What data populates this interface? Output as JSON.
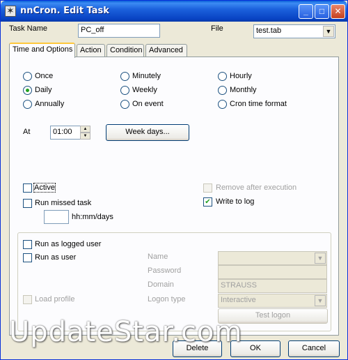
{
  "window": {
    "title": "nnCron. Edit Task",
    "minimize_glyph": "_",
    "maximize_glyph": "□",
    "close_glyph": "✕"
  },
  "header": {
    "task_name_label": "Task Name",
    "task_name_value": "PC_off",
    "file_label": "File",
    "file_value": "test.tab"
  },
  "tabs": [
    {
      "label": "Time and Options",
      "active": true
    },
    {
      "label": "Action",
      "active": false
    },
    {
      "label": "Condition",
      "active": false
    },
    {
      "label": "Advanced",
      "active": false
    }
  ],
  "schedule_options": [
    {
      "label": "Once",
      "selected": false
    },
    {
      "label": "Minutely",
      "selected": false
    },
    {
      "label": "Hourly",
      "selected": false
    },
    {
      "label": "Daily",
      "selected": true
    },
    {
      "label": "Weekly",
      "selected": false
    },
    {
      "label": "Monthly",
      "selected": false
    },
    {
      "label": "Annually",
      "selected": false
    },
    {
      "label": "On event",
      "selected": false
    },
    {
      "label": "Cron time format",
      "selected": false
    }
  ],
  "at": {
    "label": "At",
    "value": "01:00",
    "week_days_button": "Week days...",
    "spin_up": "▲",
    "spin_down": "▼"
  },
  "options": {
    "active": {
      "label": "Active",
      "checked": false
    },
    "run_missed": {
      "label": "Run missed task",
      "checked": false
    },
    "missed_unit": "hh:mm/days",
    "remove_after": {
      "label": "Remove after execution",
      "checked": false,
      "disabled": true
    },
    "write_to_log": {
      "label": "Write to log",
      "checked": true
    }
  },
  "user": {
    "run_as_logged": {
      "label": "Run as logged user",
      "checked": false
    },
    "run_as_user": {
      "label": "Run as user",
      "checked": false
    },
    "load_profile": {
      "label": "Load profile",
      "checked": false,
      "disabled": true
    },
    "name_label": "Name",
    "name_value": "",
    "password_label": "Password",
    "domain_label": "Domain",
    "domain_value": "STRAUSS",
    "logon_type_label": "Logon type",
    "logon_type_value": "Interactive",
    "test_logon_button": "Test logon",
    "combo_arrow": "▼"
  },
  "footer": {
    "delete_button": "Delete",
    "ok_button": "OK",
    "cancel_button": "Cancel"
  },
  "watermark": "UpdateStar.com",
  "colors": {
    "titlebar": "#0842c2",
    "dialog_bg": "#ece9d8",
    "tab_highlight": "#ffc83c",
    "check_mark": "#21a121"
  }
}
